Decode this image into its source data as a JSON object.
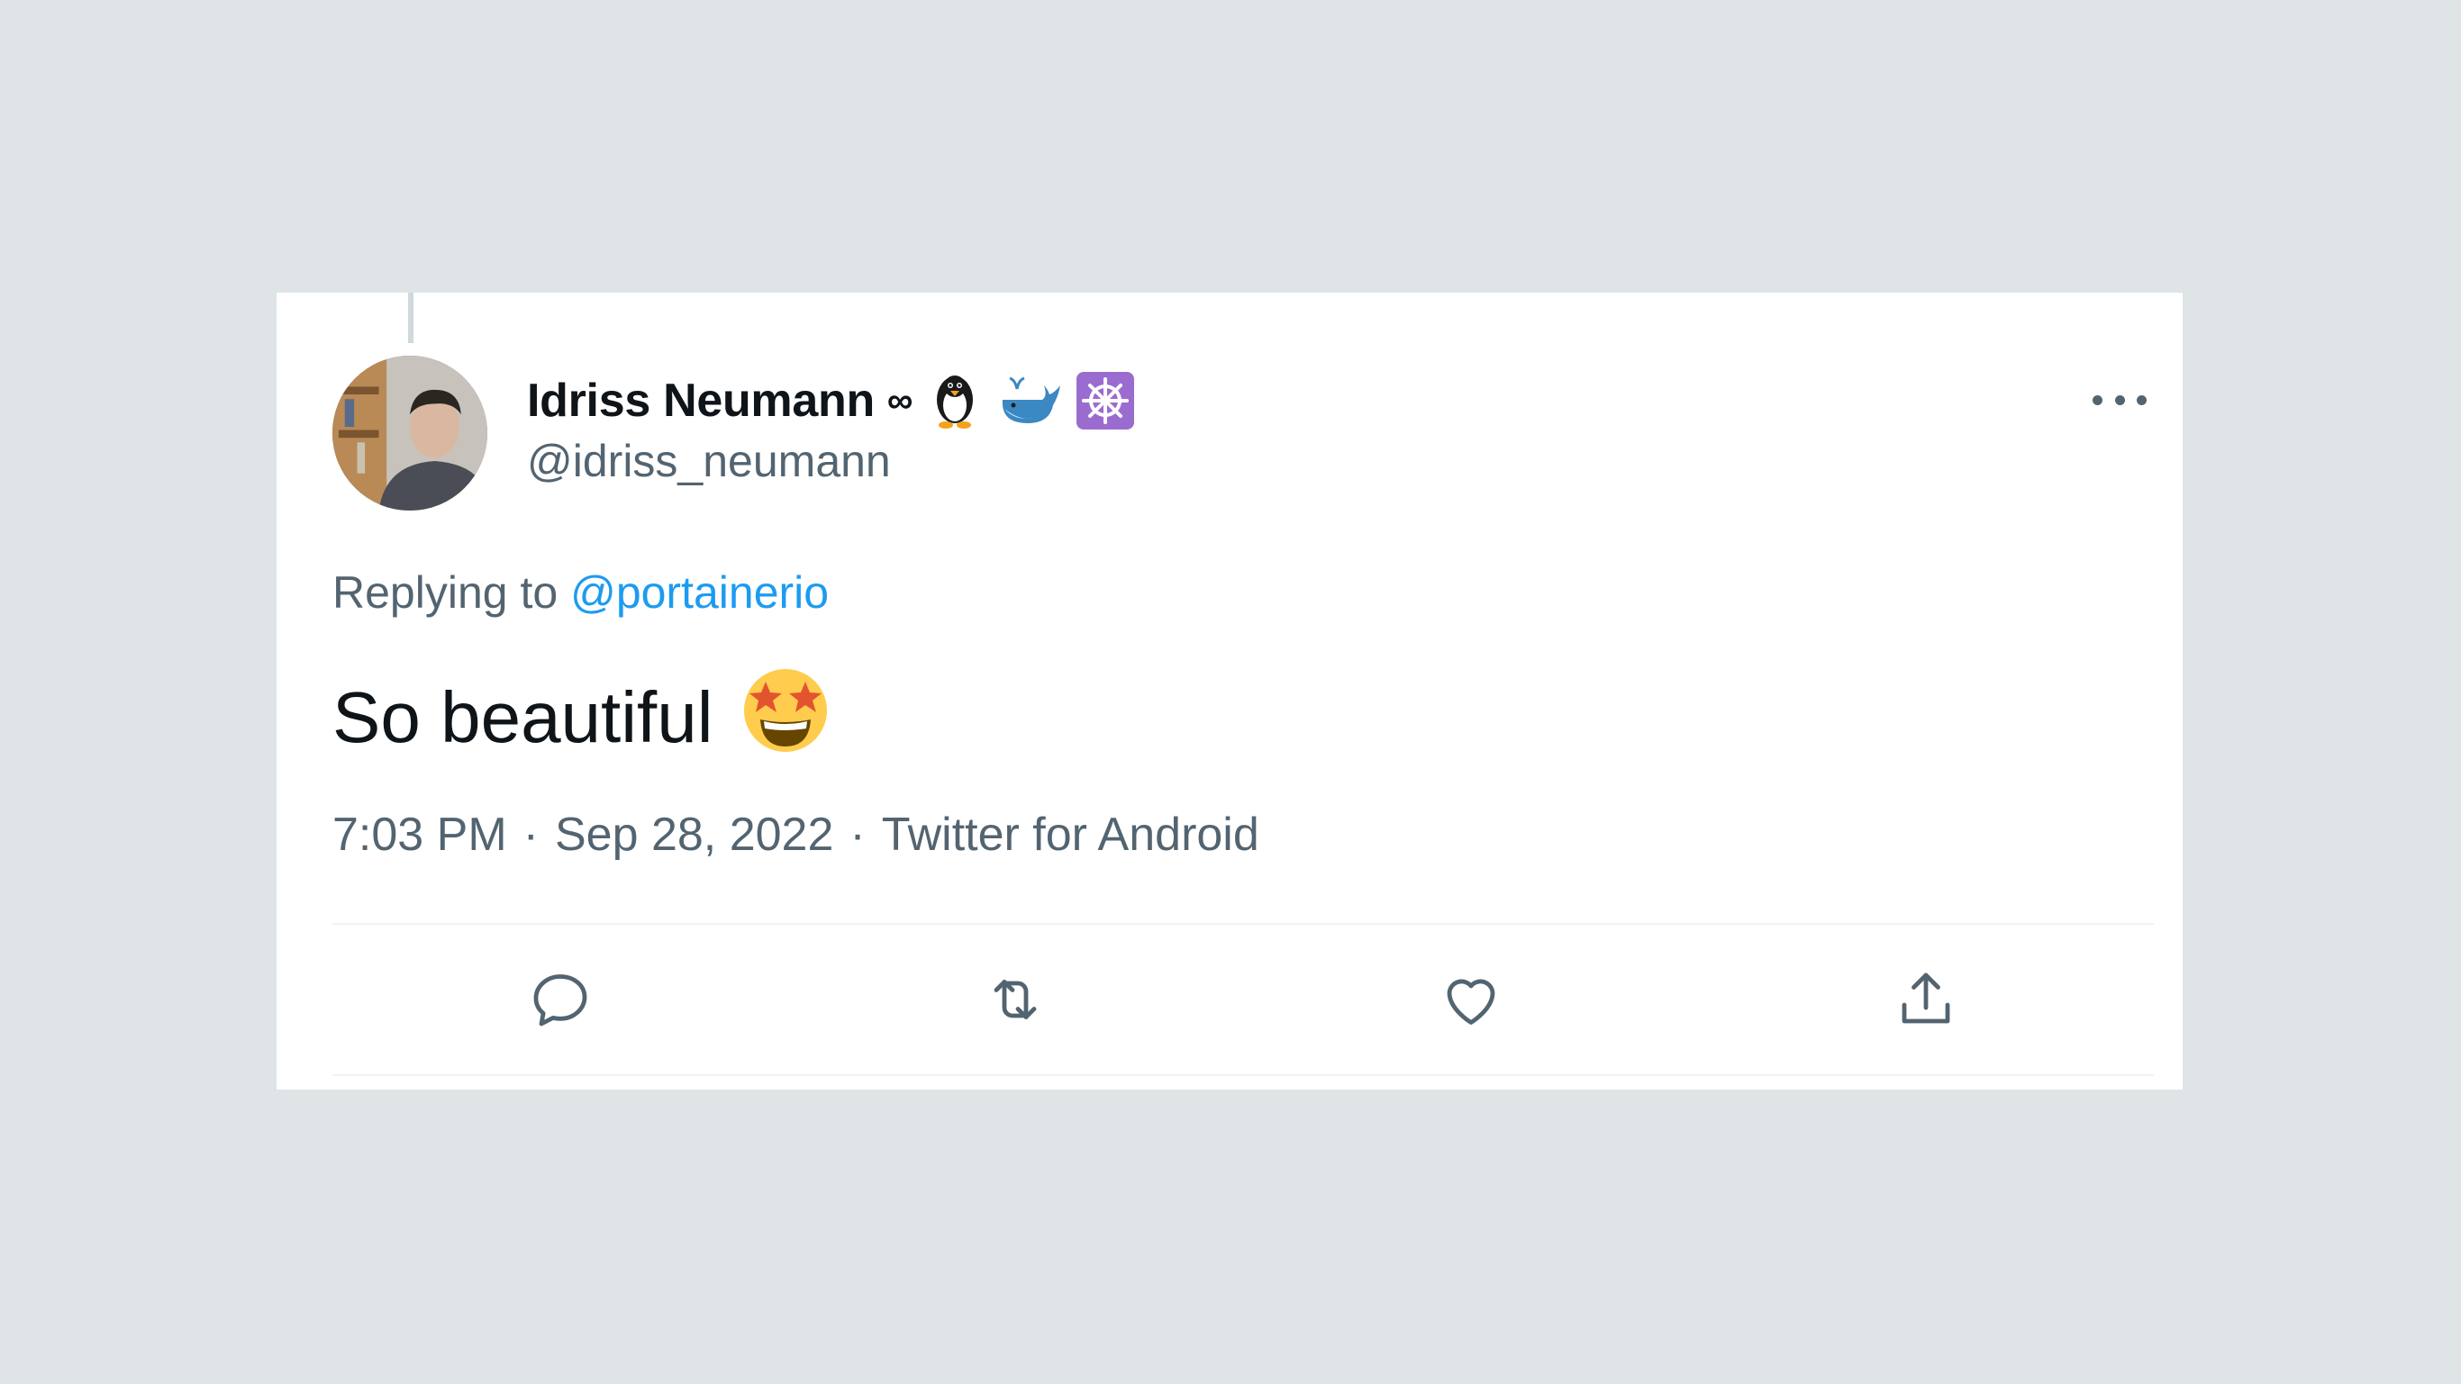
{
  "author": {
    "display_name": "Idriss Neumann",
    "name_symbol": "∞",
    "handle": "@idriss_neumann",
    "badges": [
      "penguin-emoji",
      "whale-emoji",
      "helm-wheel-emoji"
    ]
  },
  "reply": {
    "prefix": "Replying to",
    "mention": "@portainerio"
  },
  "tweet": {
    "text": "So beautiful",
    "emoji": "star-struck-emoji"
  },
  "meta": {
    "time": "7:03 PM",
    "separator": "·",
    "date": "Sep 28, 2022",
    "source": "Twitter for Android"
  },
  "actions": [
    "reply-icon",
    "retweet-icon",
    "like-icon",
    "share-icon"
  ],
  "colors": {
    "background": "#dfe4e7",
    "card": "#ffffff",
    "text_primary": "#0f1419",
    "text_secondary": "#536471",
    "link": "#1d9bf0"
  }
}
